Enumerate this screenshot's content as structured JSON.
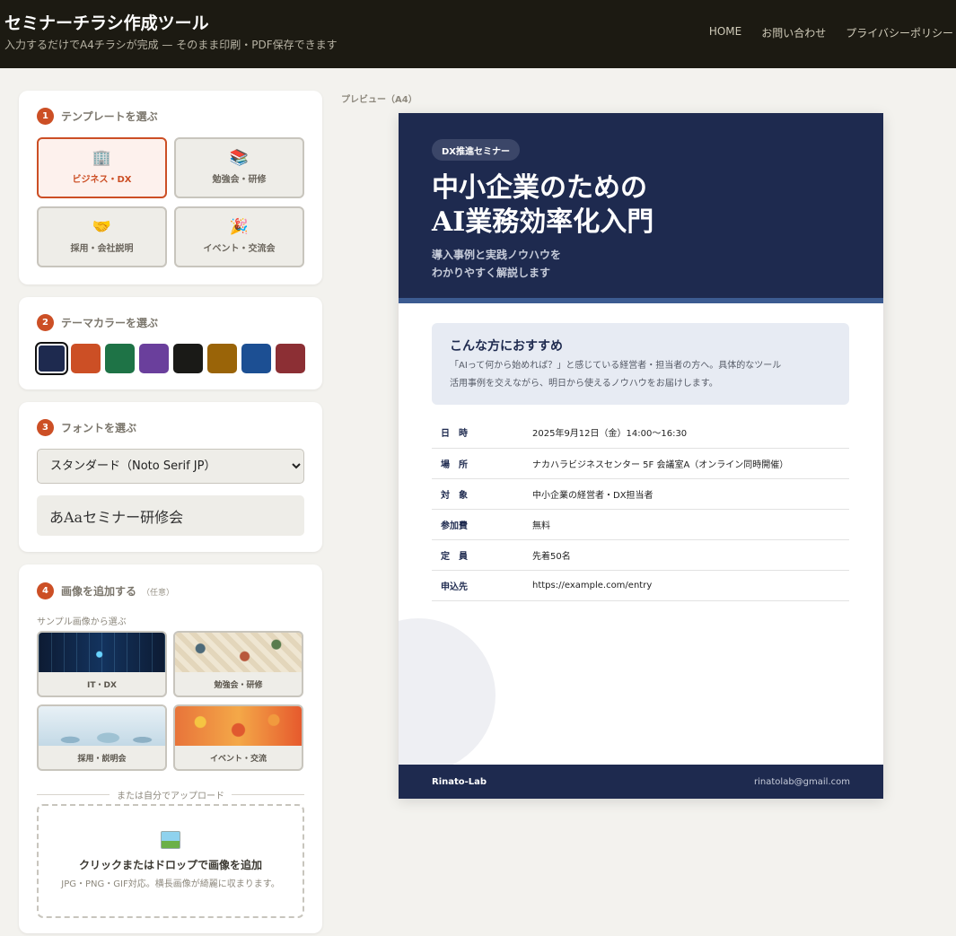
{
  "header": {
    "title": "セミナーチラシ作成ツール",
    "subtitle": "入力するだけでA4チラシが完成 — そのまま印刷・PDF保存できます",
    "nav": [
      "HOME",
      "お問い合わせ",
      "プライバシーポリシー"
    ]
  },
  "template_section": {
    "step": "1",
    "label": "テンプレートを選ぶ",
    "items": [
      {
        "label": "ビジネス・DX",
        "icon": "building-icon",
        "selected": true
      },
      {
        "label": "勉強会・研修",
        "icon": "books-icon",
        "selected": false
      },
      {
        "label": "採用・会社説明",
        "icon": "handshake-icon",
        "selected": false
      },
      {
        "label": "イベント・交流会",
        "icon": "party-popper-icon",
        "selected": false
      }
    ]
  },
  "color_section": {
    "step": "2",
    "label": "テーマカラーを選ぶ",
    "colors": [
      "#1e2a4f",
      "#cc4f25",
      "#1e7346",
      "#6a3f9c",
      "#1a1a17",
      "#9a6408",
      "#1c4f93",
      "#8c2f34"
    ],
    "selected_index": 0
  },
  "font_section": {
    "step": "3",
    "label": "フォントを選ぶ",
    "selected": "スタンダード（Noto Serif JP）",
    "preview": "あAaセミナー研修会"
  },
  "image_section": {
    "step": "4",
    "label": "画像を追加する",
    "optional": "（任意）",
    "sample_heading": "サンプル画像から選ぶ",
    "samples": [
      "IT・DX",
      "勉強会・研修",
      "採用・説明会",
      "イベント・交流"
    ],
    "divider": "または自分でアップロード",
    "upload_title": "クリックまたはドロップで画像を追加",
    "upload_note": "JPG・PNG・GIF対応。横長画像が綺麗に収まります。"
  },
  "preview": {
    "label": "プレビュー（A4）",
    "tag": "DX推進セミナー",
    "title_line1": "中小企業のための",
    "title_line2": "AI業務効率化入門",
    "subtitle_line1": "導入事例と実践ノウハウを",
    "subtitle_line2": "わかりやすく解説します",
    "recommend_title": "こんな方におすすめ",
    "recommend_line1": "「AIって何から始めれば？」と感じている経営者・担当者の方へ。具体的なツール",
    "recommend_line2": "活用事例を交えながら、明日から使えるノウハウをお届けします。",
    "details": [
      {
        "key": "日　時",
        "value": "2025年9月12日（金）14:00〜16:30"
      },
      {
        "key": "場　所",
        "value": "ナカハラビジネスセンター 5F 会議室A（オンライン同時開催）"
      },
      {
        "key": "対　象",
        "value": "中小企業の経営者・DX担当者"
      },
      {
        "key": "参加費",
        "value": "無料"
      },
      {
        "key": "定　員",
        "value": "先着50名"
      },
      {
        "key": "申込先",
        "value": "https://example.com/entry"
      }
    ],
    "footer_brand": "Rinato-Lab",
    "footer_email": "rinatolab@gmail.com"
  }
}
